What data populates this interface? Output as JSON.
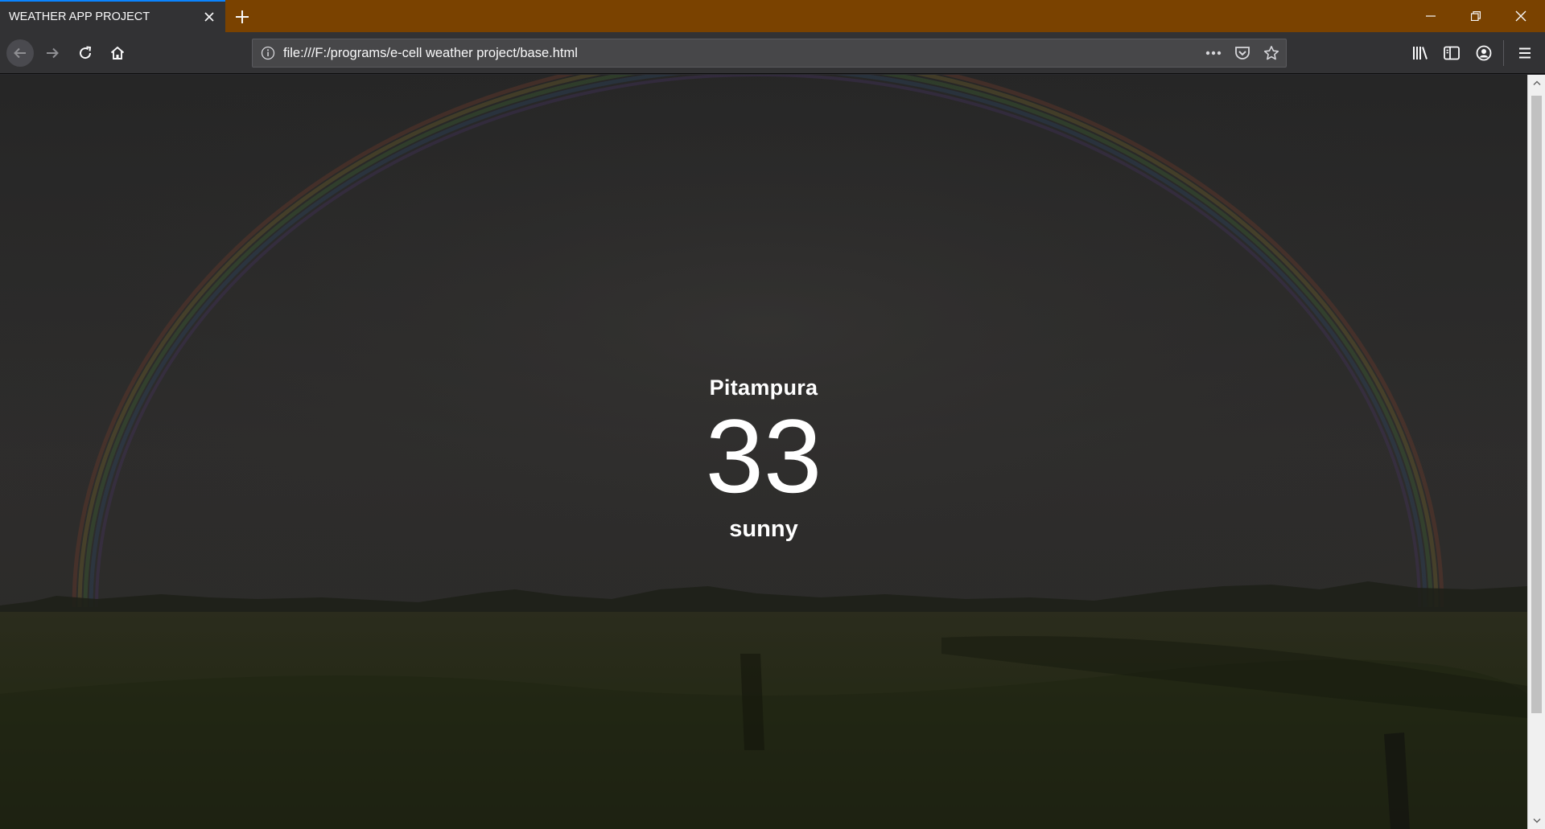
{
  "browser": {
    "tab": {
      "title": "WEATHER APP PROJECT",
      "close_icon": "close-icon"
    },
    "new_tab_icon": "plus-icon",
    "window_controls": [
      "minimize-icon",
      "restore-icon",
      "close-icon"
    ],
    "nav": {
      "back_icon": "arrow-left-icon",
      "forward_icon": "arrow-right-icon",
      "reload_icon": "reload-icon",
      "home_icon": "home-icon"
    },
    "url": "file:///F:/programs/e-cell weather project/base.html",
    "url_actions": [
      "more-icon",
      "pocket-icon",
      "star-icon"
    ],
    "toolbar_icons": [
      "library-icon",
      "sidebar-icon",
      "account-icon",
      "menu-icon"
    ],
    "colors": {
      "titlebar": "#7a4200",
      "toolbar": "#323234",
      "tab_indicator": "#0a84ff"
    }
  },
  "weather": {
    "location": "Pitampura",
    "temperature": "33",
    "condition": "sunny"
  }
}
